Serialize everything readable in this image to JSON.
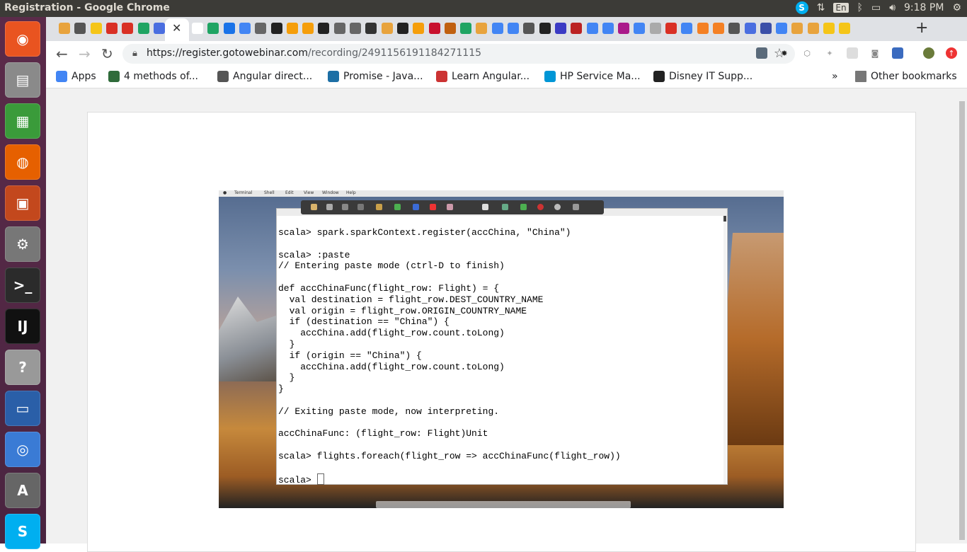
{
  "window": {
    "title": "Registration - Google Chrome"
  },
  "system_tray": {
    "keyboard_layout": "En",
    "clock": "9:18 PM"
  },
  "launcher": {
    "items": [
      {
        "name": "ubuntu-dash-icon",
        "glyph": "◉",
        "color": "#e95420"
      },
      {
        "name": "files-icon",
        "glyph": "▤",
        "color": "#8a8a8a"
      },
      {
        "name": "spreadsheet-icon",
        "glyph": "▦",
        "color": "#3a9b3a"
      },
      {
        "name": "firefox-icon",
        "glyph": "◍",
        "color": "#e66000"
      },
      {
        "name": "presentation-icon",
        "glyph": "▣",
        "color": "#c3481d"
      },
      {
        "name": "settings-icon",
        "glyph": "⚙",
        "color": "#777"
      },
      {
        "name": "terminal-icon",
        "glyph": ">_",
        "color": "#2b2b2b"
      },
      {
        "name": "intellij-icon",
        "glyph": "IJ",
        "color": "#111"
      },
      {
        "name": "help-icon",
        "glyph": "?",
        "color": "#999"
      },
      {
        "name": "writer-icon",
        "glyph": "▭",
        "color": "#2a5fa8"
      },
      {
        "name": "chrome-icon",
        "glyph": "◎",
        "color": "#3a7bd5"
      },
      {
        "name": "software-updater-icon",
        "glyph": "A",
        "color": "#666"
      },
      {
        "name": "skype-launcher-icon",
        "glyph": "S",
        "color": "#00aff0"
      }
    ]
  },
  "browser": {
    "url_host": "https://register.gotowebinar.com",
    "url_path": "/recording/2491156191184271115",
    "bookmarks": [
      {
        "label": "Apps",
        "name": "bookmark-apps",
        "color": "#4285f4"
      },
      {
        "label": "4 methods of...",
        "name": "bookmark-4-methods",
        "color": "#2f6b3a"
      },
      {
        "label": "Angular direct...",
        "name": "bookmark-angular-directives",
        "color": "#555"
      },
      {
        "label": "Promise - Java...",
        "name": "bookmark-promise",
        "color": "#1d6fa5"
      },
      {
        "label": "Learn Angular...",
        "name": "bookmark-learn-angular",
        "color": "#c33"
      },
      {
        "label": "HP Service Ma...",
        "name": "bookmark-hp-service",
        "color": "#0096d6"
      },
      {
        "label": "Disney IT Supp...",
        "name": "bookmark-disney-it",
        "color": "#222"
      }
    ],
    "bookmarks_overflow": "»",
    "other_bookmarks": "Other bookmarks"
  },
  "recording": {
    "mac_menu": [
      "Terminal",
      "Shell",
      "Edit",
      "View",
      "Window",
      "Help"
    ],
    "terminal_lines": [
      "scala> spark.sparkContext.register(accChina, \"China\")",
      "",
      "scala> :paste",
      "// Entering paste mode (ctrl-D to finish)",
      "",
      "def accChinaFunc(flight_row: Flight) = {",
      "  val destination = flight_row.DEST_COUNTRY_NAME",
      "  val origin = flight_row.ORIGIN_COUNTRY_NAME",
      "  if (destination == \"China\") {",
      "    accChina.add(flight_row.count.toLong)",
      "  }",
      "  if (origin == \"China\") {",
      "    accChina.add(flight_row.count.toLong)",
      "  }",
      "}",
      "",
      "// Exiting paste mode, now interpreting.",
      "",
      "accChinaFunc: (flight_row: Flight)Unit",
      "",
      "scala> flights.foreach(flight_row => accChinaFunc(flight_row))",
      "",
      "scala> "
    ]
  }
}
